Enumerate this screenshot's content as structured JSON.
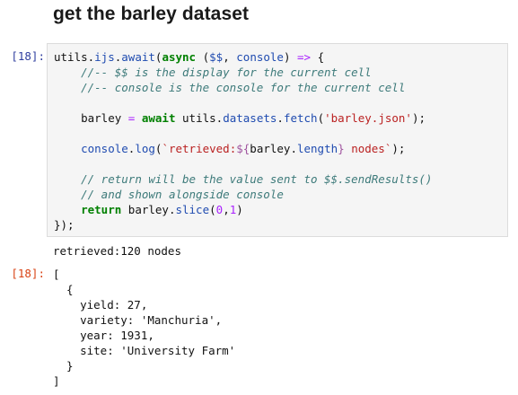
{
  "heading": "get the barley dataset",
  "input_prompt": "[18]:",
  "output_prompt": "[18]:",
  "code": {
    "l1_a": "utils.",
    "l1_b": "ijs",
    "l1_c": ".",
    "l1_d": "await",
    "l1_e": "(",
    "l1_f": "async",
    "l1_g": " (",
    "l1_h": "$$",
    "l1_i": ", ",
    "l1_j": "console",
    "l1_k": ") ",
    "l1_l": "=>",
    "l1_m": " {",
    "l2": "//-- $$ is the display for the current cell",
    "l3": "//-- console is the console for the current cell",
    "l5_a": "barley ",
    "l5_b": "=",
    "l5_c": " ",
    "l5_d": "await",
    "l5_e": " utils.",
    "l5_f": "datasets",
    "l5_g": ".",
    "l5_h": "fetch",
    "l5_i": "(",
    "l5_j": "'barley.json'",
    "l5_k": ");",
    "l7_a": "console",
    "l7_b": ".",
    "l7_c": "log",
    "l7_d": "(",
    "l7_e": "`retrieved:",
    "l7_f": "${",
    "l7_g": "barley.",
    "l7_h": "length",
    "l7_i": "}",
    "l7_j": " nodes`",
    "l7_k": ");",
    "l9": "// return will be the value sent to $$.sendResults()",
    "l10": "// and shown alongside console",
    "l11_a": "return",
    "l11_b": " barley.",
    "l11_c": "slice",
    "l11_d": "(",
    "l11_e": "0",
    "l11_f": ",",
    "l11_g": "1",
    "l11_h": ")",
    "l12": "});"
  },
  "stdout": "retrieved:120 nodes",
  "result": "[\n  {\n    yield: 27,\n    variety: 'Manchuria',\n    year: 1931,\n    site: 'University Farm'\n  }\n]"
}
